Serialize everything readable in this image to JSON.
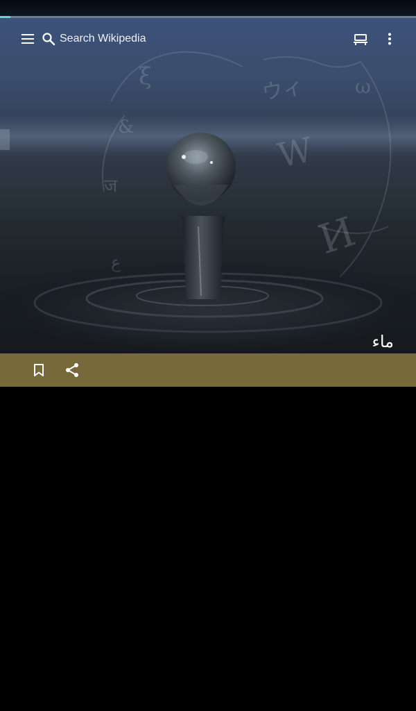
{
  "loading": {
    "progress_percent": 2.5
  },
  "header": {
    "menu_icon": "hamburger-menu-icon",
    "search": {
      "icon": "search-icon",
      "placeholder": "Search Wikipedia"
    },
    "tabs_icon": "tabs-icon",
    "overflow_icon": "more-vert-icon"
  },
  "article": {
    "title": "ماء",
    "lead_image": "water-drop-splash"
  },
  "action_bar": {
    "bookmark_icon": "bookmark-icon",
    "share_icon": "share-icon"
  },
  "colors": {
    "action_bar": "#776939",
    "progress": "#6fd0cf",
    "background": "#000000",
    "icon": "#ffffff"
  }
}
